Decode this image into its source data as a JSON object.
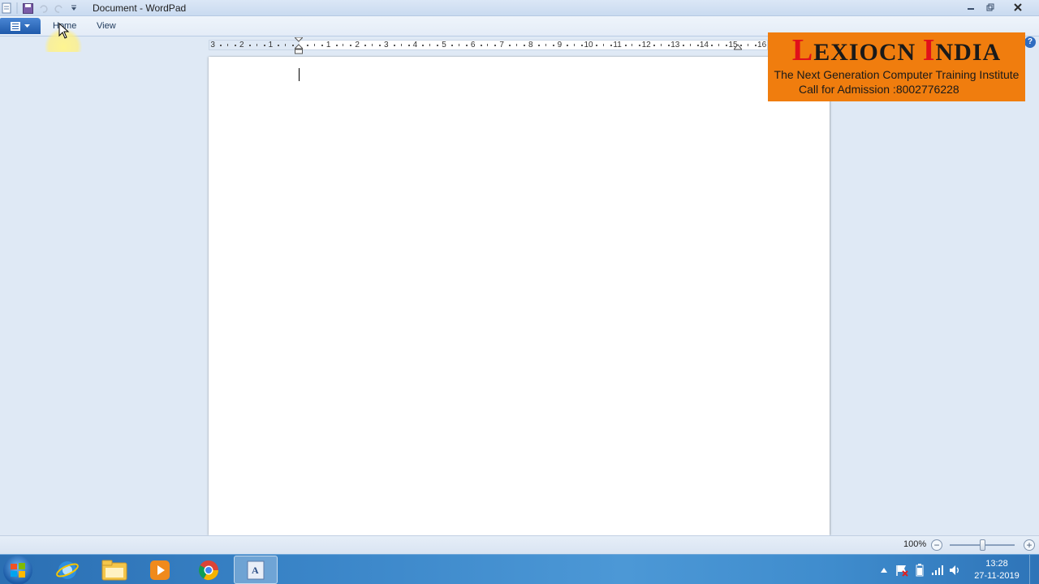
{
  "window": {
    "title": "Document - WordPad"
  },
  "ribbon": {
    "tabs": [
      {
        "label": "Home"
      },
      {
        "label": "View"
      }
    ]
  },
  "ruler": {
    "labels": [
      "3",
      "2",
      "1",
      "1",
      "2",
      "3",
      "4",
      "5",
      "6",
      "7",
      "8",
      "9",
      "10",
      "11",
      "12",
      "13",
      "14",
      "15",
      "16"
    ]
  },
  "banner": {
    "title_first_letter": "L",
    "title_rest_1": "EXIOCN ",
    "title_second_letter": "I",
    "title_rest_2": "NDIA",
    "subtitle": "The Next Generation Computer Training Institute",
    "phone_line": "Call for Admission :8002776228"
  },
  "statusbar": {
    "zoom_label": "100%",
    "zoom_out": "−",
    "zoom_in": "+",
    "zoom_level": 1.0
  },
  "taskbar": {
    "items": [
      "windows-start-icon",
      "internet-explorer-icon",
      "file-explorer-icon",
      "media-player-icon",
      "chrome-icon",
      "wordpad-icon"
    ],
    "clock_time": "13:28",
    "clock_date": "27-11-2019"
  },
  "colors": {
    "banner_bg": "#f07d0e",
    "banner_accent": "#e0101a",
    "taskbar": "#3a85c8"
  }
}
